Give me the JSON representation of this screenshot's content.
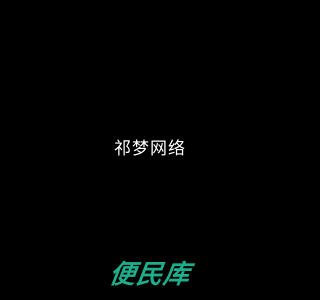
{
  "screen": {
    "title": "祁梦网络"
  },
  "logo": {
    "text": "便民库",
    "color": "#1fae8c"
  },
  "colors": {
    "background": "#000000",
    "title_text": "#ffffff"
  }
}
